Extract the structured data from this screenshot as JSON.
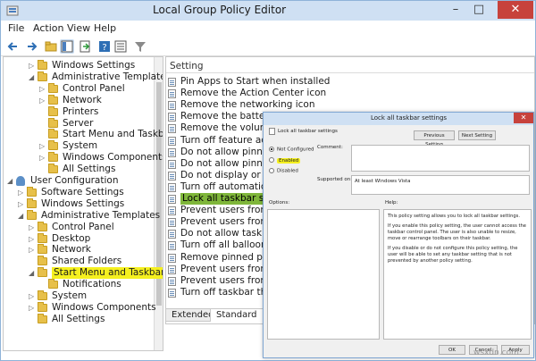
{
  "window": {
    "title": "Local Group Policy Editor"
  },
  "controls": {
    "minimize": "–",
    "maximize": "□",
    "close": "✕"
  },
  "menu": [
    "File",
    "Action",
    "View",
    "Help"
  ],
  "tree": {
    "items": [
      {
        "label": "Windows Settings",
        "depth": 2,
        "arrow": "▷"
      },
      {
        "label": "Administrative Templates",
        "depth": 2,
        "arrow": "◢"
      },
      {
        "label": "Control Panel",
        "depth": 3,
        "arrow": "▷"
      },
      {
        "label": "Network",
        "depth": 3,
        "arrow": "▷"
      },
      {
        "label": "Printers",
        "depth": 3,
        "arrow": ""
      },
      {
        "label": "Server",
        "depth": 3,
        "arrow": ""
      },
      {
        "label": "Start Menu and Taskbar",
        "depth": 3,
        "arrow": ""
      },
      {
        "label": "System",
        "depth": 3,
        "arrow": "▷"
      },
      {
        "label": "Windows Components",
        "depth": 3,
        "arrow": "▷"
      },
      {
        "label": "All Settings",
        "depth": 3,
        "arrow": ""
      },
      {
        "label": "User Configuration",
        "depth": 0,
        "arrow": "◢"
      },
      {
        "label": "Software Settings",
        "depth": 1,
        "arrow": "▷"
      },
      {
        "label": "Windows Settings",
        "depth": 1,
        "arrow": "▷"
      },
      {
        "label": "Administrative Templates",
        "depth": 1,
        "arrow": "◢"
      },
      {
        "label": "Control Panel",
        "depth": 2,
        "arrow": "▷"
      },
      {
        "label": "Desktop",
        "depth": 2,
        "arrow": "▷"
      },
      {
        "label": "Network",
        "depth": 2,
        "arrow": "▷"
      },
      {
        "label": "Shared Folders",
        "depth": 2,
        "arrow": ""
      },
      {
        "label": "Start Menu and Taskbar",
        "depth": 2,
        "arrow": "◢",
        "selected": true
      },
      {
        "label": "Notifications",
        "depth": 3,
        "arrow": ""
      },
      {
        "label": "System",
        "depth": 2,
        "arrow": "▷"
      },
      {
        "label": "Windows Components",
        "depth": 2,
        "arrow": "▷"
      },
      {
        "label": "All Settings",
        "depth": 2,
        "arrow": ""
      }
    ]
  },
  "settings": {
    "header": "Setting",
    "items": [
      "Pin Apps to Start when installed",
      "Remove the Action Center icon",
      "Remove the networking icon",
      "Remove the battery mete",
      "Remove the volume cont",
      "Turn off feature advertise",
      "Do not allow pinning ite",
      "Do not allow pinning pro",
      "Do not display or track ite",
      "Turn off automatic prom",
      "Lock all taskbar settings",
      "Prevent users from addin",
      "Prevent users from rearra",
      "Do not allow taskbars on",
      "Turn off all balloon notifi",
      "Remove pinned program",
      "Prevent users from movi",
      "Prevent users from resizin",
      "Turn off taskbar thumbn"
    ],
    "selected_index": 10
  },
  "tabs": [
    "Extended",
    "Standard"
  ],
  "dialog": {
    "title": "Lock all taskbar settings",
    "policy_name": "Lock all taskbar settings",
    "prev_button": "Previous Setting",
    "next_button": "Next Setting",
    "options": [
      "Not Configured",
      "Enabled",
      "Disabled"
    ],
    "selected_option": "Not Configured",
    "highlight_option": "Enabled",
    "comment_label": "Comment:",
    "supported_label": "Supported on:",
    "supported_value": "At least Windows Vista",
    "options_label": "Options:",
    "help_label": "Help:",
    "help_paragraphs": [
      "This policy setting allows you to lock all taskbar settings.",
      "If you enable this policy setting, the user cannot access the taskbar control panel. The user is also unable to resize, move or rearrange toolbars on their taskbar.",
      "If you disable or do not configure this policy setting, the user will be able to set any taskbar setting that is not prevented by another policy setting."
    ],
    "ok_button": "OK",
    "cancel_button": "Cancel",
    "apply_button": "Apply"
  },
  "watermark": "wsxdn.com",
  "colors": {
    "highlight_yellow": "#f5f01f",
    "selected_green": "#7fb63a",
    "title_blue": "#cfe0f3"
  }
}
